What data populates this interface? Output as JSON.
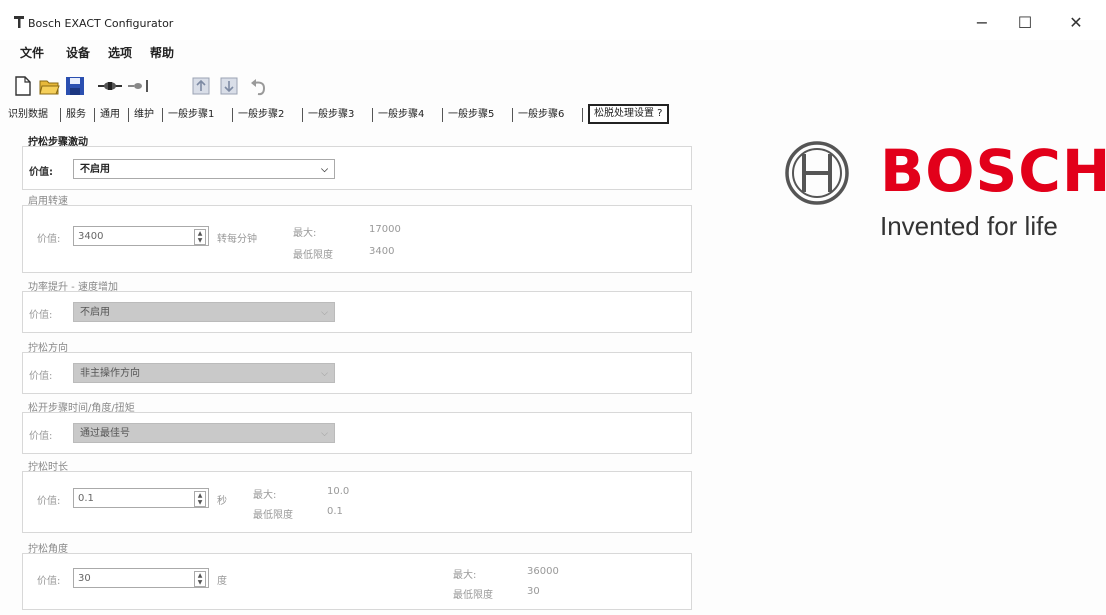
{
  "window": {
    "title": "Bosch EXACT Configurator",
    "minimize": "−",
    "maximize": "☐",
    "close": "✕"
  },
  "menu": [
    "文件",
    "设备",
    "选项",
    "帮助"
  ],
  "tabs": [
    "识别数据",
    "服务",
    "通用",
    "维护",
    "一般步骤1",
    "一般步骤2",
    "一般步骤3",
    "一般步骤4",
    "一般步骤5",
    "一般步骤6",
    "松脱处理设置 ?"
  ],
  "sections": {
    "stepper": {
      "title": "拧松步骤激动",
      "value_label": "价值:",
      "value": "不启用"
    },
    "speed": {
      "title": "启用转速",
      "value_label": "价值:",
      "value": "3400",
      "unit": "转每分钟",
      "max_label": "最大:",
      "max_value": "17000",
      "min_label": "最低限度",
      "min_value": "3400"
    },
    "power": {
      "title": "功率提升 - 速度增加",
      "value_label": "价值:",
      "value": "不启用"
    },
    "direction": {
      "title": "拧松方向",
      "value_label": "价值:",
      "value": "非主操作方向"
    },
    "step_params": {
      "title": "松开步骤时间/角度/扭矩",
      "value_label": "价值:",
      "value": "通过最佳号"
    },
    "duration": {
      "title": "拧松时长",
      "value_label": "价值:",
      "value": "0.1",
      "unit": "秒",
      "max_label": "最大:",
      "max_value": "10.0",
      "min_label": "最低限度",
      "min_value": "0.1"
    },
    "angle": {
      "title": "拧松角度",
      "value_label": "价值:",
      "value": "30",
      "unit": "度",
      "max_label": "最大:",
      "max_value": "36000",
      "min_label": "最低限度",
      "min_value": "30"
    }
  },
  "brand": {
    "name": "BOSCH",
    "tagline": "Invented for life",
    "color": "#e2001a"
  },
  "toolbar_icons": [
    "new-file-icon",
    "open-folder-icon",
    "save-icon",
    "connect-icon",
    "disconnect-icon",
    "upload-icon",
    "download-icon",
    "undo-icon"
  ]
}
